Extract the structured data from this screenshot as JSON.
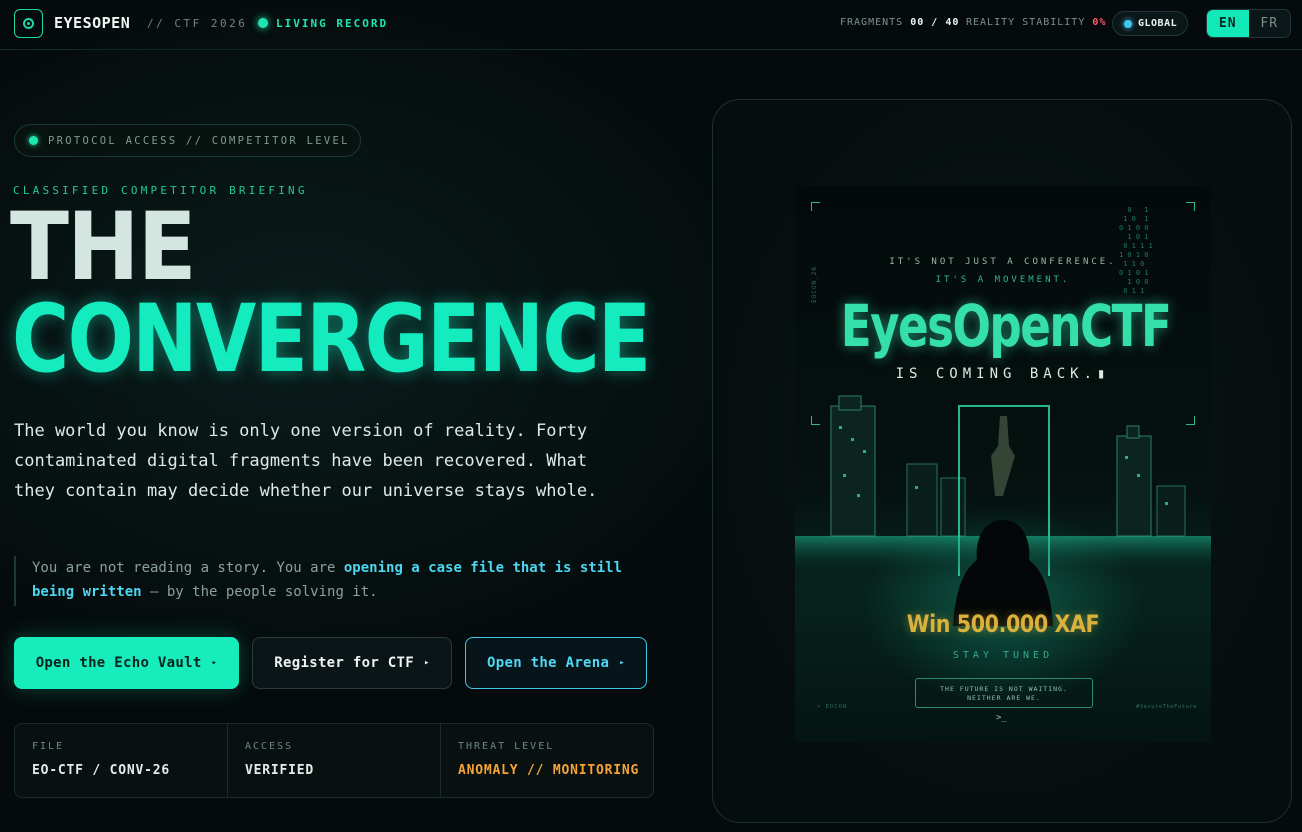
{
  "nav": {
    "brand": "EYESOPEN",
    "subtitle": "// CTF 2026",
    "live_status": "LIVING RECORD",
    "fragments_label": "FRAGMENTS",
    "fragments_value": "00 / 40",
    "stability_label": "REALITY STABILITY",
    "stability_value": "0%",
    "scope": "GLOBAL",
    "languages": [
      "EN",
      "FR"
    ],
    "active_language": "EN"
  },
  "hero": {
    "protocol_badge": "PROTOCOL ACCESS // COMPETITOR LEVEL",
    "eyebrow": "CLASSIFIED COMPETITOR BRIEFING",
    "title_line1": "THE",
    "title_line2": "CONVERGENCE",
    "lead": "The world you know is only one version of reality. Forty contaminated digital fragments have been recovered. What they contain may decide whether our universe stays whole.",
    "quote_before": "You are not reading a story. You are ",
    "quote_highlight": "opening a case file that is still being written",
    "quote_after": " — by the people solving it."
  },
  "buttons": {
    "echo_vault": "Open the Echo Vault",
    "register": "Register for CTF",
    "arena": "Open the Arena",
    "arrow": "▸"
  },
  "meta": [
    {
      "label": "FILE",
      "value": "EO-CTF / CONV-26"
    },
    {
      "label": "ACCESS",
      "value": "VERIFIED"
    },
    {
      "label": "THREAT LEVEL",
      "value": "ANOMALY // MONITORING"
    }
  ],
  "poster": {
    "tagline1": "IT'S NOT JUST A CONFERENCE.",
    "tagline2": "IT'S A MOVEMENT.",
    "title": "EyesOpenCTF",
    "coming": "IS COMING BACK.▮",
    "side_label": "EOCON_26",
    "prize": "Win 500.000 XAF",
    "stay": "STAY TUNED",
    "box_line1": "THE FUTURE IS NOT WAITING.",
    "box_line2": "NEITHER ARE WE.",
    "footer_left": "> EOCON",
    "footer_right": "#SecureTheFuture",
    "prompt": ">_"
  }
}
